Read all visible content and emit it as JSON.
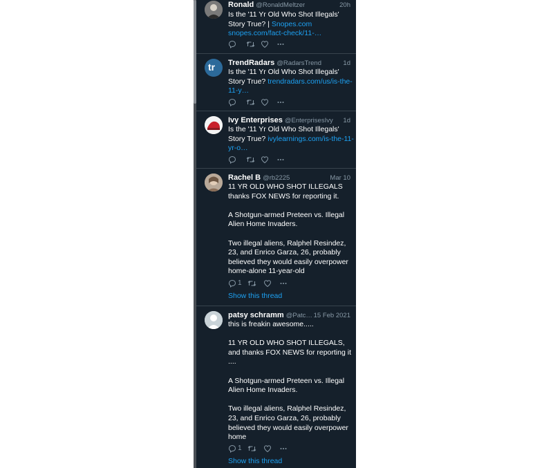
{
  "tweets": [
    {
      "name": "Ronald",
      "handle": "@RonaldMeltzer",
      "time": "20h",
      "text": "Is the '11 Yr Old Who Shot Illegals' Story True? | ",
      "link": "Snopes.com",
      "text2": "",
      "link2": "snopes.com/fact-check/11-…",
      "avatar": "photo-avatar"
    },
    {
      "name": "TrendRadars",
      "handle": "@RadarsTrend",
      "time": "1d",
      "text": "Is the '11 Yr Old Who Shot Illegals' Story True? ",
      "link": "trendradars.com/us/is-the-11-y…",
      "avatar_text": "tr"
    },
    {
      "name": "Ivy Enterprises",
      "handle": "@EnterprisesIvy",
      "time": "1d",
      "text": "Is the '11 Yr Old Who Shot Illegals' Story True? ",
      "link": "ivylearnings.com/is-the-11-yr-o…"
    },
    {
      "name": "Rachel B",
      "handle": "@rb2225",
      "time": "Mar 10",
      "text": "11 YR OLD WHO SHOT ILLEGALS thanks FOX NEWS for reporting it.\n\nA Shotgun-armed Preteen vs. Illegal Alien Home Invaders.\n\nTwo illegal aliens, Ralphel Resindez, 23, and Enrico Garza, 26, probably believed they would easily overpower home-alone 11-year-old",
      "reply_count": "1",
      "thread_link": "Show this thread"
    },
    {
      "name": "patsy schramm",
      "handle": "@Patc…",
      "time": "15 Feb 2021",
      "text": "this is freakin awesome.....\n\n11 YR OLD WHO SHOT ILLEGALS, and thanks FOX NEWS for reporting it ....\n\nA Shotgun-armed Preteen vs. Illegal Alien Home Invaders.\n\nTwo illegal aliens, Ralphel Resindez, 23, and Enrico Garza, 26, probably believed they would easily overpower home",
      "reply_count": "1",
      "thread_link": "Show this thread"
    }
  ],
  "icons": [
    "reply-icon",
    "retweet-icon",
    "like-icon",
    "more-icon"
  ],
  "colors": {
    "background": "#15202b",
    "link": "#1da1f2",
    "muted": "#8899a6",
    "divider": "#38444d"
  }
}
